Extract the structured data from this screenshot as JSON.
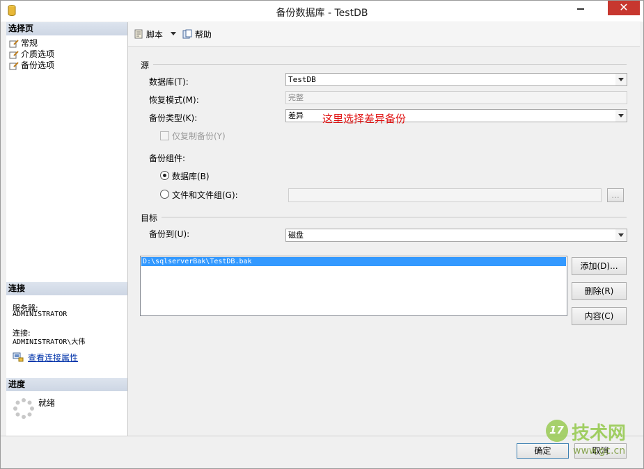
{
  "window": {
    "title": "备份数据库 - TestDB",
    "close_glyph": "✕"
  },
  "left": {
    "select_page_header": "选择页",
    "pages": [
      {
        "label": "常规"
      },
      {
        "label": "介质选项"
      },
      {
        "label": "备份选项"
      }
    ],
    "connection_header": "连接",
    "server_label": "服务器:",
    "server_value": "ADMINISTRATOR",
    "connection_label": "连接:",
    "connection_value": "ADMINISTRATOR\\大伟",
    "view_props_link": "查看连接属性",
    "progress_header": "进度",
    "progress_status": "就绪"
  },
  "toolbar": {
    "script_label": "脚本",
    "help_label": "帮助"
  },
  "source": {
    "group_label": "源",
    "database_label": "数据库(T):",
    "database_value": "TestDB",
    "recovery_label": "恢复模式(M):",
    "recovery_value": "完整",
    "backup_type_label": "备份类型(K):",
    "backup_type_value": "差异",
    "copy_only_label": "仅复制备份(Y)",
    "component_label": "备份组件:",
    "radio_database_label": "数据库(B)",
    "radio_files_label": "文件和文件组(G):",
    "files_browse_label": "..."
  },
  "destination": {
    "group_label": "目标",
    "backup_to_label": "备份到(U):",
    "backup_to_value": "磁盘",
    "paths": [
      "D:\\sqlserverBak\\TestDB.bak"
    ],
    "add_button": "添加(D)...",
    "remove_button": "删除(R)",
    "contents_button": "内容(C)"
  },
  "annotation": "这里选择差异备份",
  "footer": {
    "ok_button": "确定",
    "cancel_button": "取消"
  },
  "watermark": {
    "text": "技术网",
    "badge": "17",
    "url": "www.gc.cn"
  },
  "colors": {
    "accent": "#3399ff",
    "annotation": "#e01010",
    "close": "#c7372f",
    "link": "#0033aa"
  }
}
